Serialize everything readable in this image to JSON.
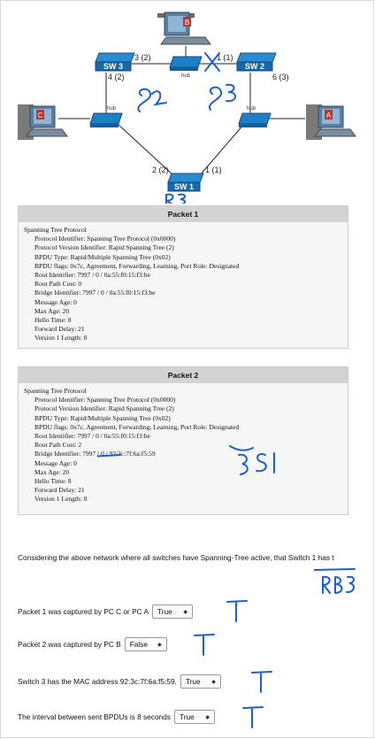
{
  "diagram": {
    "pc_b": "B",
    "pc_c": "C",
    "pc_a": "A",
    "sw3": "SW 3",
    "sw2": "SW 2",
    "sw1": "SW 1",
    "hub": "hub",
    "sw3_port_right": "3 (2)",
    "sw3_port_down": "4 (2)",
    "sw2_port_left": "1 (1)",
    "sw2_port_down": "6 (3)",
    "sw1_port_left": "2 (2)",
    "sw1_port_right": "1 (1)",
    "handwriting": {
      "s2": "S2",
      "s3": "S3",
      "r3": "R3",
      "s1": "S1",
      "rb3": "RB3",
      "mark": "T"
    },
    "ink_color": "#1a5fd6"
  },
  "packets": [
    {
      "header": "Packet 1",
      "title": "Spanning Tree Protocol",
      "fields": [
        "Protocol Identifier: Spanning Tree Protocol (0x0000)",
        "Protocol Version Identifier: Rapid Spanning Tree (2)",
        "BPDU Type: Rapid/Multiple Spanning Tree (0x02)",
        "BPDU flags: 0x7c, Agreement, Forwarding, Learning, Port Role: Designated",
        "Root Identifier: 7997 / 0 / 0a:55:f0:15:f3:be",
        "Root Path Cost: 0",
        "Bridge Identifier: 7997 / 0 / 0a:55:f0:15:f3:be",
        "Message Age: 0",
        "Max Age: 20",
        "Hello Time: 8",
        "Forward Delay: 21",
        "Version 1 Length: 0"
      ]
    },
    {
      "header": "Packet 2",
      "title": "Spanning Tree Protocol",
      "fields": [
        "Protocol Identifier: Spanning Tree Protocol (0x0000)",
        "Protocol Version Identifier: Rapid Spanning Tree (2)",
        "BPDU Type: Rapid/Multiple Spanning Tree (0x02)",
        "BPDU flags: 0x7c, Agreement, Forwarding, Learning, Port Role: Designated",
        "Root Identifier: 7997 / 0 / 0a:55:f0:15:f3:be",
        "Root Path Cost: 2",
        "Bridge Identifier: 7997 / 0 / 92:3c:7f:6a:f5:59",
        "Message Age: 0",
        "Max Age: 20",
        "Hello Time: 8",
        "Forward Delay: 21",
        "Version 1 Length: 0"
      ]
    }
  ],
  "intro": "Considering the above network where all switches have Spanning-Tree active, that Switch 1 has t",
  "questions": [
    {
      "text": "Packet 1 was captured by PC C or PC A",
      "answer": "True"
    },
    {
      "text": "Packet 2 was captured by PC B",
      "answer": "False"
    },
    {
      "text": "Switch 3 has the MAC address 92:3c:7f:6a:f5:59.",
      "answer": "True"
    },
    {
      "text": "The interval between sent BPDUs is 8 seconds",
      "answer": "True"
    }
  ]
}
